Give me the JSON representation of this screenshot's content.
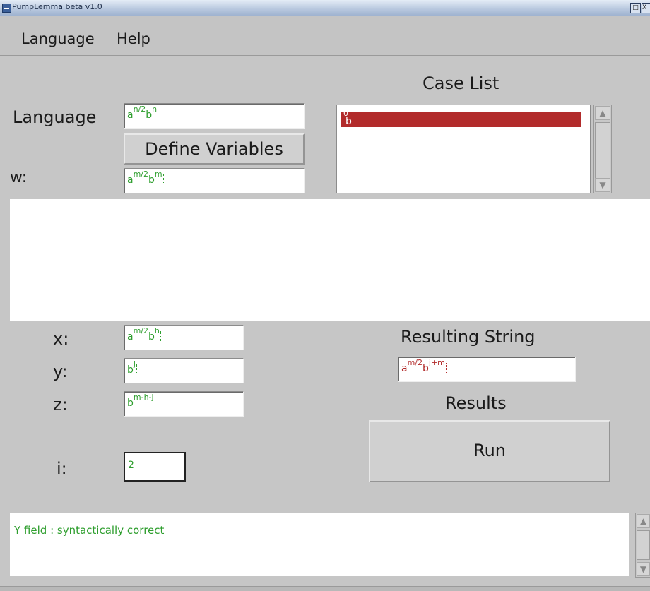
{
  "window": {
    "title": "PumpLemma beta v1.0",
    "max_glyph": "□",
    "close_glyph": "X"
  },
  "menu": {
    "items": [
      "Language",
      "Help"
    ]
  },
  "language": {
    "label": "Language",
    "base": "a",
    "exp1": "n/2",
    "mid": "b",
    "exp2": "n"
  },
  "define_button": {
    "label": "Define Variables"
  },
  "w": {
    "label": "w:",
    "base": "a",
    "exp1": "m/2",
    "mid": "b",
    "exp2": "m"
  },
  "case_list": {
    "title": "Case List",
    "items": [
      {
        "base": "b",
        "exp": "0",
        "selected": true
      }
    ]
  },
  "x": {
    "label": "x:",
    "base": "a",
    "exp1": "m/2",
    "mid": "b",
    "exp2": "h"
  },
  "y": {
    "label": "y:",
    "base": "b",
    "exp1": "j"
  },
  "z": {
    "label": "z:",
    "base": "b",
    "exp1": "m-h-j"
  },
  "i": {
    "label": "i:",
    "value": "2"
  },
  "resulting": {
    "title": "Resulting String",
    "base": "a",
    "exp1": "m/2",
    "mid": "b",
    "exp2": "j+m"
  },
  "results": {
    "title": "Results"
  },
  "run_button": {
    "label": "Run"
  },
  "status": {
    "message": "Y field : syntactically correct"
  },
  "colors": {
    "field_text": "#2e9e2e",
    "result_text": "#b22b2b",
    "selection": "#b22b2b",
    "panel_bg": "#c6c6c6"
  },
  "icons": [
    "window-menu-icon",
    "maximize-icon",
    "close-icon",
    "scroll-up-arrow-icon",
    "scroll-down-arrow-icon"
  ]
}
